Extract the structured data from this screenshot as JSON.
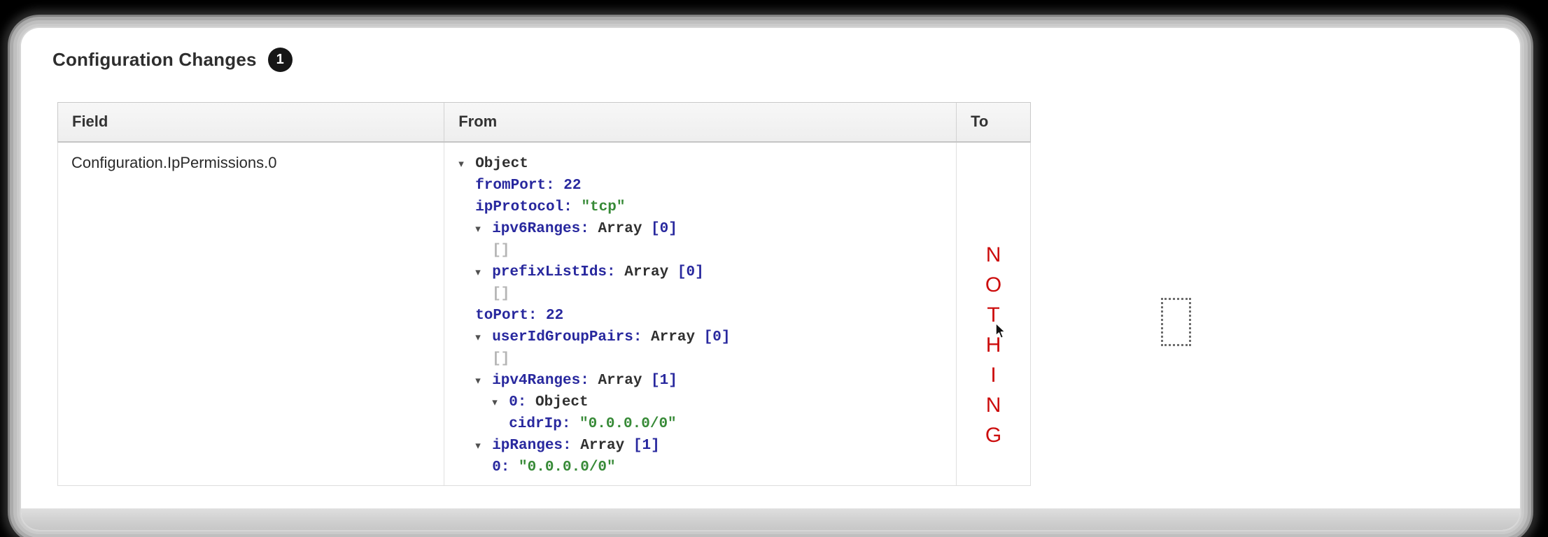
{
  "header": {
    "title": "Configuration Changes",
    "badge_count": "1"
  },
  "table": {
    "columns": [
      {
        "label": "Field"
      },
      {
        "label": "From"
      },
      {
        "label": "To"
      }
    ],
    "row": {
      "field": "Configuration.IpPermissions.0",
      "from_tree": {
        "rows": [
          {
            "depth": 0,
            "expandable": true,
            "segments": [
              {
                "type": "plain",
                "text": "Object"
              }
            ]
          },
          {
            "depth": 1,
            "expandable": false,
            "segments": [
              {
                "type": "key",
                "text": "fromPort: "
              },
              {
                "type": "num",
                "text": "22"
              }
            ]
          },
          {
            "depth": 1,
            "expandable": false,
            "segments": [
              {
                "type": "key",
                "text": "ipProtocol: "
              },
              {
                "type": "string",
                "text": "\"tcp\""
              }
            ]
          },
          {
            "depth": 1,
            "expandable": true,
            "segments": [
              {
                "type": "key",
                "text": "ipv6Ranges: "
              },
              {
                "type": "plain",
                "text": "Array "
              },
              {
                "type": "bracket",
                "text": "[0]"
              }
            ]
          },
          {
            "depth": 2,
            "expandable": false,
            "segments": [
              {
                "type": "empty",
                "text": "[]"
              }
            ]
          },
          {
            "depth": 1,
            "expandable": true,
            "segments": [
              {
                "type": "key",
                "text": "prefixListIds: "
              },
              {
                "type": "plain",
                "text": "Array "
              },
              {
                "type": "bracket",
                "text": "[0]"
              }
            ]
          },
          {
            "depth": 2,
            "expandable": false,
            "segments": [
              {
                "type": "empty",
                "text": "[]"
              }
            ]
          },
          {
            "depth": 1,
            "expandable": false,
            "segments": [
              {
                "type": "key",
                "text": "toPort: "
              },
              {
                "type": "num",
                "text": "22"
              }
            ]
          },
          {
            "depth": 1,
            "expandable": true,
            "segments": [
              {
                "type": "key",
                "text": "userIdGroupPairs: "
              },
              {
                "type": "plain",
                "text": "Array "
              },
              {
                "type": "bracket",
                "text": "[0]"
              }
            ]
          },
          {
            "depth": 2,
            "expandable": false,
            "segments": [
              {
                "type": "empty",
                "text": "[]"
              }
            ]
          },
          {
            "depth": 1,
            "expandable": true,
            "segments": [
              {
                "type": "key",
                "text": "ipv4Ranges: "
              },
              {
                "type": "plain",
                "text": "Array "
              },
              {
                "type": "bracket",
                "text": "[1]"
              }
            ]
          },
          {
            "depth": 2,
            "expandable": true,
            "segments": [
              {
                "type": "key",
                "text": "0: "
              },
              {
                "type": "plain",
                "text": "Object"
              }
            ]
          },
          {
            "depth": 3,
            "expandable": false,
            "segments": [
              {
                "type": "key",
                "text": "cidrIp: "
              },
              {
                "type": "string",
                "text": "\"0.0.0.0/0\""
              }
            ]
          },
          {
            "depth": 1,
            "expandable": true,
            "segments": [
              {
                "type": "key",
                "text": "ipRanges: "
              },
              {
                "type": "plain",
                "text": "Array "
              },
              {
                "type": "bracket",
                "text": "[1]"
              }
            ]
          },
          {
            "depth": 2,
            "expandable": false,
            "segments": [
              {
                "type": "key",
                "text": "0: "
              },
              {
                "type": "string",
                "text": "\"0.0.0.0/0\""
              }
            ]
          }
        ]
      },
      "to_text": "NOTHING"
    }
  },
  "icons": {
    "expand_triangle": "▾"
  },
  "colors": {
    "json_key": "#28289e",
    "json_number": "#28289e",
    "json_string": "#378a37",
    "json_plain": "#303030",
    "json_empty_bracket": "#b5b5b5",
    "triangle": "#4f4f4f",
    "nothing_text": "#cc0d0d",
    "badge_bg": "#161616",
    "badge_text": "#ffffff"
  }
}
